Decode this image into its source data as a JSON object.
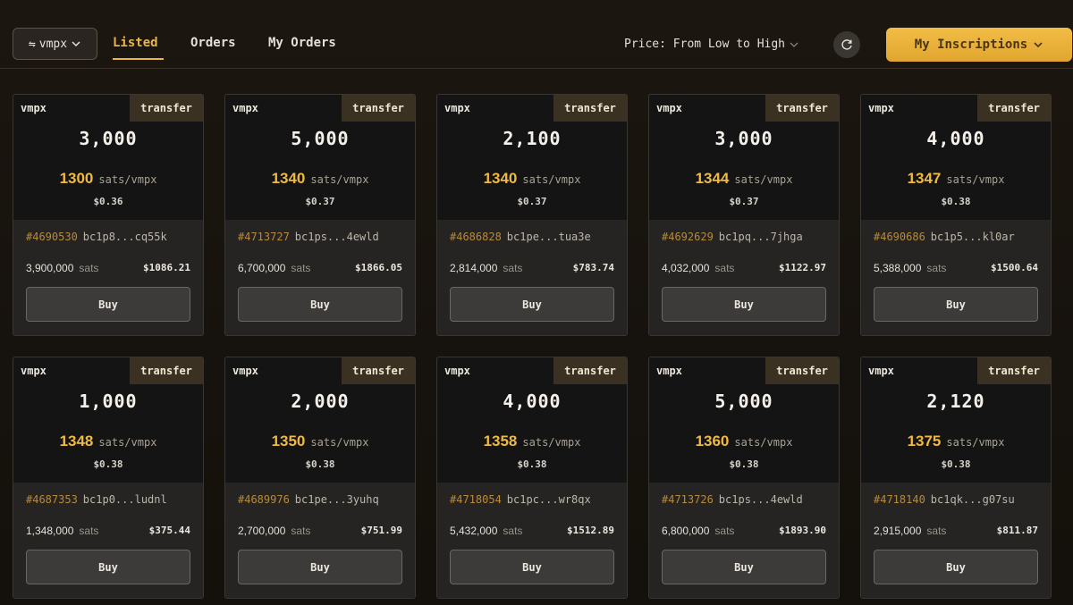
{
  "header": {
    "ticker_label": "vmpx",
    "tabs": [
      "Listed",
      "Orders",
      "My Orders"
    ],
    "sort_label": "Price: From Low to High",
    "inscriptions_label": "My Inscriptions"
  },
  "card_common": {
    "badge": "transfer",
    "unit": "sats/vmpx",
    "sats_unit": "sats",
    "buy_label": "Buy"
  },
  "colors": {
    "accent": "#e7b54a",
    "background": "#16120d",
    "card": "#141414"
  },
  "listings": [
    {
      "ticker": "vmpx",
      "amount": "3,000",
      "price": "1300",
      "usd": "$0.36",
      "inscription": "#4690530",
      "address": "bc1p8...cq55k",
      "sats": "3,900,000",
      "total": "$1086.21"
    },
    {
      "ticker": "vmpx",
      "amount": "5,000",
      "price": "1340",
      "usd": "$0.37",
      "inscription": "#4713727",
      "address": "bc1ps...4ewld",
      "sats": "6,700,000",
      "total": "$1866.05"
    },
    {
      "ticker": "vmpx",
      "amount": "2,100",
      "price": "1340",
      "usd": "$0.37",
      "inscription": "#4686828",
      "address": "bc1pe...tua3e",
      "sats": "2,814,000",
      "total": "$783.74"
    },
    {
      "ticker": "vmpx",
      "amount": "3,000",
      "price": "1344",
      "usd": "$0.37",
      "inscription": "#4692629",
      "address": "bc1pq...7jhga",
      "sats": "4,032,000",
      "total": "$1122.97"
    },
    {
      "ticker": "vmpx",
      "amount": "4,000",
      "price": "1347",
      "usd": "$0.38",
      "inscription": "#4690686",
      "address": "bc1p5...kl0ar",
      "sats": "5,388,000",
      "total": "$1500.64"
    },
    {
      "ticker": "vmpx",
      "amount": "1,000",
      "price": "1348",
      "usd": "$0.38",
      "inscription": "#4687353",
      "address": "bc1p0...ludnl",
      "sats": "1,348,000",
      "total": "$375.44"
    },
    {
      "ticker": "vmpx",
      "amount": "2,000",
      "price": "1350",
      "usd": "$0.38",
      "inscription": "#4689976",
      "address": "bc1pe...3yuhq",
      "sats": "2,700,000",
      "total": "$751.99"
    },
    {
      "ticker": "vmpx",
      "amount": "4,000",
      "price": "1358",
      "usd": "$0.38",
      "inscription": "#4718054",
      "address": "bc1pc...wr8qx",
      "sats": "5,432,000",
      "total": "$1512.89"
    },
    {
      "ticker": "vmpx",
      "amount": "5,000",
      "price": "1360",
      "usd": "$0.38",
      "inscription": "#4713726",
      "address": "bc1ps...4ewld",
      "sats": "6,800,000",
      "total": "$1893.90"
    },
    {
      "ticker": "vmpx",
      "amount": "2,120",
      "price": "1375",
      "usd": "$0.38",
      "inscription": "#4718140",
      "address": "bc1qk...g07su",
      "sats": "2,915,000",
      "total": "$811.87"
    }
  ]
}
